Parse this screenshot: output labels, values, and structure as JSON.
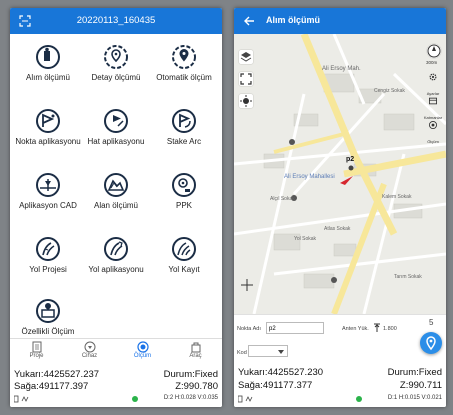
{
  "left": {
    "title": "20220113_160435",
    "tiles": [
      {
        "label": "Alım ölçümü",
        "icon": "survey-person-icon"
      },
      {
        "label": "Detay ölçümü",
        "icon": "detail-pin-icon"
      },
      {
        "label": "Otomatik ölçüm",
        "icon": "auto-pin-icon"
      },
      {
        "label": "Nokta aplikasyonu",
        "icon": "point-stakeout-icon"
      },
      {
        "label": "Hat aplikasyonu",
        "icon": "line-stakeout-icon"
      },
      {
        "label": "Stake Arc",
        "icon": "arc-stakeout-icon"
      },
      {
        "label": "Aplikasyon CAD",
        "icon": "cad-stakeout-icon"
      },
      {
        "label": "Alan ölçümü",
        "icon": "area-survey-icon"
      },
      {
        "label": "PPK",
        "icon": "ppk-icon"
      },
      {
        "label": "Yol Projesi",
        "icon": "road-project-icon"
      },
      {
        "label": "Yol aplikasyonu",
        "icon": "road-stakeout-icon"
      },
      {
        "label": "Yol Kayıt",
        "icon": "road-record-icon"
      },
      {
        "label": "Özellikli Ölçüm",
        "icon": "feature-survey-icon"
      }
    ],
    "nav": [
      {
        "label": "Proje",
        "icon": "project-icon"
      },
      {
        "label": "Cihaz",
        "icon": "device-icon"
      },
      {
        "label": "Ölçüm",
        "icon": "measure-icon",
        "active": true
      },
      {
        "label": "Araç",
        "icon": "tool-icon"
      }
    ],
    "status": {
      "north": "Yukarı:4425527.237",
      "solution": "Durum:Fixed",
      "east": "Sağa:491177.397",
      "z": "Z:990.780",
      "precision": "D:2 H:0.028 V:0.035"
    }
  },
  "right": {
    "title": "Alım ölçümü",
    "map": {
      "labels": [
        "Ali Ersoy Mah.",
        "Ali Ersoy Mahallesi",
        "Alçıl Sokak",
        "Kalem Sokak",
        "Cengiz Sokak",
        "Atlas Sokak",
        "Tarım Sokak",
        "Yol Sokak"
      ],
      "scale": "300m",
      "point_label": "p2",
      "side_labels": [
        "Saf",
        "Ayarlar",
        "Katmanlar",
        "Ölçüm"
      ]
    },
    "form": {
      "point_name_label": "Nokta Adı",
      "point_name_value": "p2",
      "antenna_label": "Anten Yük.",
      "antenna_value": "1.800",
      "code_label": "Kod",
      "count": "5"
    },
    "status": {
      "north": "Yukarı:4425527.230",
      "solution": "Durum:Fixed",
      "east": "Sağa:491177.377",
      "z": "Z:990.711",
      "precision": "D:1 H:0.015 V:0.021"
    }
  },
  "colors": {
    "accent": "#1876d8",
    "fix": "#2bb34a",
    "road": "#f7e79a"
  }
}
